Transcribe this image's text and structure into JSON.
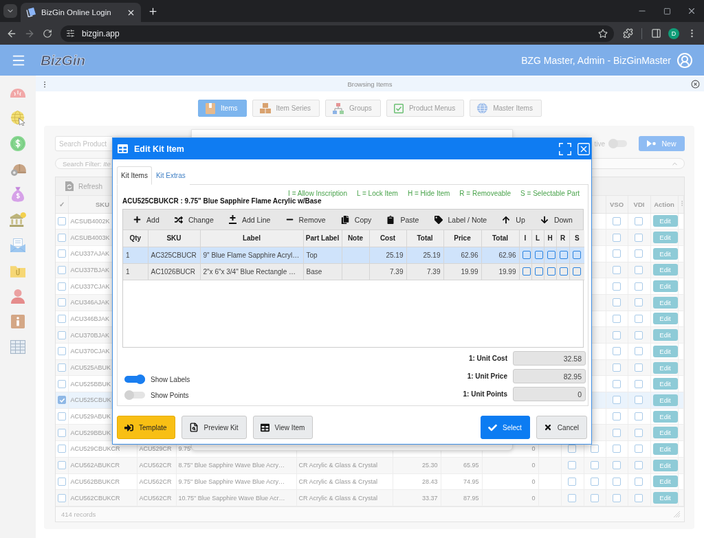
{
  "browser": {
    "tab_title": "BizGin Online Login",
    "url": "bizgin.app",
    "profile_initial": "D"
  },
  "header": {
    "logo": "BizGin",
    "user": "BZG Master, Admin - BizGinMaster"
  },
  "page_bar": {
    "title": "Browsing Items"
  },
  "nav_tabs": [
    {
      "label": "Items",
      "selected": true
    },
    {
      "label": "Item Series",
      "selected": false
    },
    {
      "label": "Groups",
      "selected": false
    },
    {
      "label": "Product Menus",
      "selected": false
    },
    {
      "label": "Master Items",
      "selected": false
    }
  ],
  "search": {
    "placeholder": "Search Product"
  },
  "active_toggle": {
    "label": "tive",
    "on": false
  },
  "new_button": "New",
  "filter": {
    "label": "Search Filter: *Ite*"
  },
  "table": {
    "refresh": "Refresh",
    "header": {
      "select": "✓",
      "sku": "SKU",
      "vso": "VSO",
      "vdi": "VDI",
      "action": "Action"
    },
    "rows": [
      {
        "checked": false,
        "selected": false,
        "sku": "ACSUB4002K",
        "vso": false,
        "vdi": false,
        "action": "Edit"
      },
      {
        "checked": false,
        "selected": false,
        "sku": "ACSUB4003K",
        "vso": false,
        "vdi": false,
        "action": "Edit"
      },
      {
        "checked": false,
        "selected": false,
        "sku": "ACU337AJAK",
        "vso": false,
        "vdi": false,
        "action": "Edit"
      },
      {
        "checked": false,
        "selected": false,
        "sku": "ACU337BJAK",
        "vso": false,
        "vdi": false,
        "action": "Edit"
      },
      {
        "checked": false,
        "selected": false,
        "sku": "ACU337CJAK",
        "vso": false,
        "vdi": false,
        "action": "Edit"
      },
      {
        "checked": false,
        "selected": false,
        "sku": "ACU346AJAK",
        "vso": false,
        "vdi": false,
        "action": "Edit"
      },
      {
        "checked": false,
        "selected": false,
        "sku": "ACU346BJAK",
        "vso": false,
        "vdi": false,
        "action": "Edit"
      },
      {
        "checked": false,
        "selected": false,
        "sku": "ACU370BJAK",
        "vso": false,
        "vdi": false,
        "action": "Edit"
      },
      {
        "checked": false,
        "selected": false,
        "sku": "ACU370CJAK",
        "vso": false,
        "vdi": false,
        "action": "Edit"
      },
      {
        "checked": false,
        "selected": false,
        "sku": "ACU525ABUK",
        "vso": false,
        "vdi": false,
        "action": "Edit"
      },
      {
        "checked": false,
        "selected": false,
        "sku": "ACU525BBUK",
        "vso": false,
        "vdi": false,
        "action": "Edit"
      },
      {
        "checked": true,
        "selected": true,
        "sku": "ACU525CBUK",
        "vso": false,
        "vdi": false,
        "action": "Edit"
      },
      {
        "checked": false,
        "selected": false,
        "sku": "ACU529ABUK",
        "vso": false,
        "vdi": false,
        "action": "Edit"
      },
      {
        "checked": false,
        "selected": false,
        "sku": "ACU529BBUK",
        "vso": false,
        "vdi": false,
        "action": "Edit"
      },
      {
        "checked": false,
        "selected": false,
        "sku": "ACU529CBUKCR",
        "column_3": "ACU529CR",
        "column_4": "9.75\"",
        "column_8": "0",
        "column_10": false,
        "column_11": false,
        "vso": false,
        "vdi": false,
        "action": "Edit"
      },
      {
        "checked": false,
        "selected": false,
        "sku": "ACU562ABUKCR",
        "column_3": "ACU562CR",
        "column_4": "8.75\" Blue Sapphire Wave Blue Acry…",
        "column_5": "CR Acrylic & Glass & Crystal",
        "column_6": "25.30",
        "column_7": "65.95",
        "column_8": "0",
        "column_10": false,
        "column_11": false,
        "vso": false,
        "vdi": false,
        "action": "Edit"
      },
      {
        "checked": false,
        "selected": false,
        "sku": "ACU562BBUKCR",
        "column_3": "ACU562CR",
        "column_4": "9.75\" Blue Sapphire Wave Blue Acry…",
        "column_5": "CR Acrylic & Glass & Crystal",
        "column_6": "28.43",
        "column_7": "74.95",
        "column_8": "0",
        "column_10": false,
        "column_11": false,
        "vso": false,
        "vdi": false,
        "action": "Edit"
      },
      {
        "checked": false,
        "selected": false,
        "sku": "ACU562CBUKCR",
        "column_3": "ACU562CR",
        "column_4": "10.75\" Blue Sapphire Wave Blue Acr…",
        "column_5": "CR Acrylic & Glass & Crystal",
        "column_6": "33.37",
        "column_7": "87.95",
        "column_8": "0",
        "column_10": false,
        "column_11": false,
        "vso": false,
        "vdi": false,
        "action": "Edit"
      }
    ],
    "footer": "414 records"
  },
  "dialog": {
    "title": "Edit Kit Item",
    "tabs": [
      {
        "label": "Kit Items",
        "selected": true
      },
      {
        "label": "Kit Extras",
        "selected": false
      }
    ],
    "legend": [
      "I = Allow Inscription",
      "L = Lock Item",
      "H = Hide Item",
      "R = Removeable",
      "S = Selectable Part"
    ],
    "item_title": "ACU525CBUKCR : 9.75\" Blue Sapphire Flame Acrylic w/Base",
    "toolbar": [
      "Add",
      "Change",
      "Add Line",
      "Remove",
      "Copy",
      "Paste",
      "Label / Note",
      "Up",
      "Down"
    ],
    "columns": [
      "Qty",
      "SKU",
      "Label",
      "Part Label",
      "Note",
      "Cost",
      "Total",
      "Price",
      "Total",
      "I",
      "L",
      "H",
      "R",
      "S"
    ],
    "rows": [
      {
        "selected": true,
        "qty": "1",
        "sku": "AC325CBUCR",
        "label": "9\" Blue Flame Sapphire Acryl…",
        "part_label": "Top",
        "cost": "25.19",
        "cost_total": "25.19",
        "price": "62.96",
        "price_total": "62.96",
        "flags": [
          false,
          false,
          false,
          false,
          false
        ]
      },
      {
        "selected": false,
        "qty": "1",
        "sku": "AC1026BUCR",
        "label": "2\"x 6\"x 3/4\" Blue Rectangle …",
        "part_label": "Base",
        "cost": "7.39",
        "cost_total": "7.39",
        "price": "19.99",
        "price_total": "19.99",
        "flags": [
          false,
          false,
          false,
          false,
          false
        ]
      }
    ],
    "totals": [
      {
        "label": "1: Unit Cost",
        "value": "32.58"
      },
      {
        "label": "1: Unit Price",
        "value": "82.95"
      },
      {
        "label": "1: Unit Points",
        "value": "0"
      }
    ],
    "toggles": [
      {
        "label": "Show Labels",
        "on": true
      },
      {
        "label": "Show Points",
        "on": false
      }
    ],
    "left_buttons": [
      {
        "label": "Template",
        "kind": "warning"
      },
      {
        "label": "Preview Kit",
        "kind": "default"
      },
      {
        "label": "View Item",
        "kind": "default"
      }
    ],
    "right_buttons": [
      {
        "label": "Select",
        "kind": "primary"
      },
      {
        "label": "Cancel",
        "kind": "default"
      }
    ]
  }
}
